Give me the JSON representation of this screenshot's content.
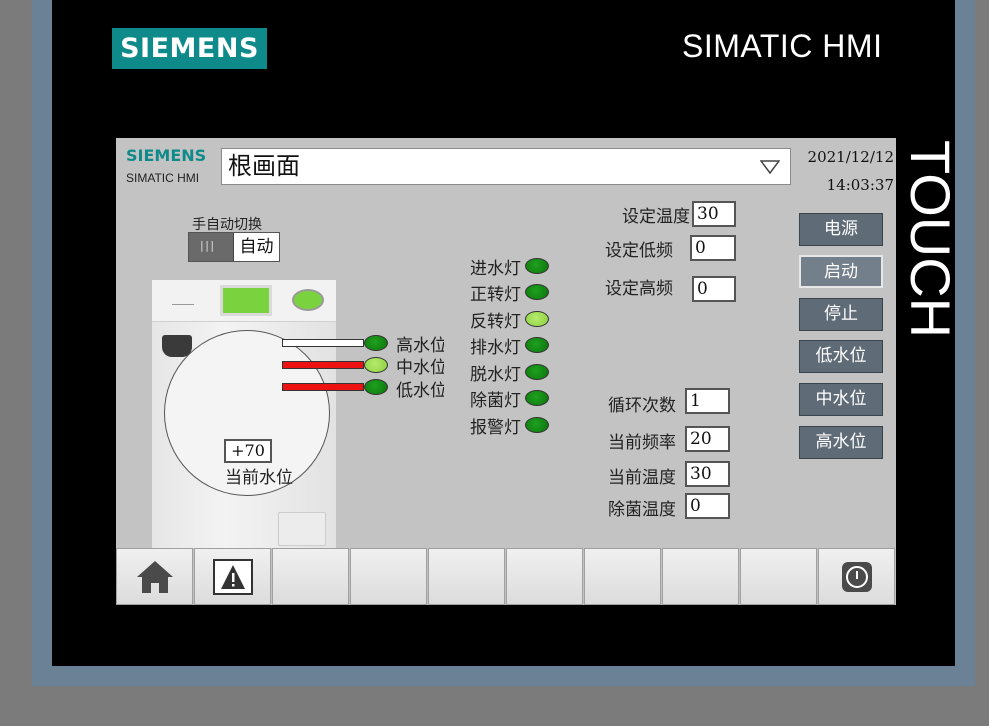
{
  "device": {
    "brand": "SIEMENS",
    "model_title": "SIMATIC HMI",
    "touch_label": "TOUCH"
  },
  "screen": {
    "logo": "SIEMENS",
    "logo_sub": "SIMATIC HMI",
    "screen_name": "根画面",
    "date": "2021/12/12",
    "time": "14:03:37",
    "mode_switch": {
      "label": "手自动切换",
      "state_text": "自动"
    },
    "water_level": {
      "label": "当前水位",
      "value": "+70"
    },
    "level_indicators": [
      {
        "label": "高水位",
        "led": "dark",
        "bar_color": "#ffffff"
      },
      {
        "label": "中水位",
        "led": "light",
        "bar_color": "#ee1111"
      },
      {
        "label": "低水位",
        "led": "dark",
        "bar_color": "#ee1111"
      }
    ],
    "status_lights": [
      {
        "label": "进水灯",
        "led": "dark"
      },
      {
        "label": "正转灯",
        "led": "dark"
      },
      {
        "label": "反转灯",
        "led": "light"
      },
      {
        "label": "排水灯",
        "led": "dark"
      },
      {
        "label": "脱水灯",
        "led": "dark"
      },
      {
        "label": "除菌灯",
        "led": "dark"
      },
      {
        "label": "报警灯",
        "led": "dark"
      }
    ],
    "settings": [
      {
        "label": "设定温度",
        "value": "30"
      },
      {
        "label": "设定低频",
        "value": "0"
      },
      {
        "label": "设定高频",
        "value": "0"
      }
    ],
    "readouts": [
      {
        "label": "循环次数",
        "value": "1"
      },
      {
        "label": "当前频率",
        "value": "20"
      },
      {
        "label": "当前温度",
        "value": "30"
      },
      {
        "label": "除菌温度",
        "value": "0"
      }
    ],
    "buttons": [
      {
        "label": "电源",
        "active": false
      },
      {
        "label": "启动",
        "active": true
      },
      {
        "label": "停止",
        "active": false
      },
      {
        "label": "低水位",
        "active": false
      },
      {
        "label": "中水位",
        "active": false
      },
      {
        "label": "高水位",
        "active": false
      }
    ],
    "bottom_bar": [
      "home-icon",
      "alarm-icon",
      "",
      "",
      "",
      "",
      "",
      "",
      "",
      "power-icon"
    ]
  },
  "colors": {
    "siemens_teal": "#0f8a8a",
    "led_dark_green": "#0b740b",
    "led_light_green": "#9ade52",
    "button_gray": "#5f6b76"
  }
}
